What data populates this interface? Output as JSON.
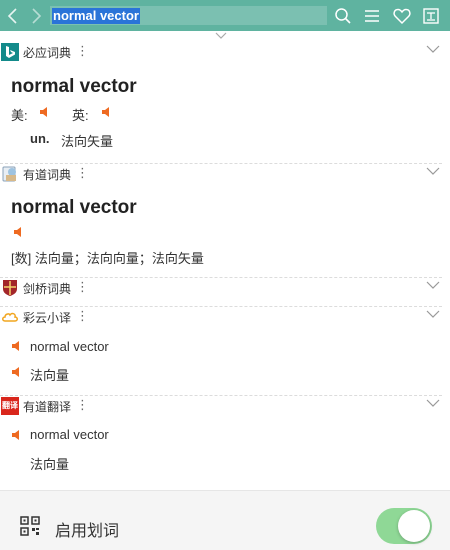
{
  "toolbar": {
    "query": "normal vector",
    "back_icon": "chevron-left-icon",
    "forward_icon": "chevron-right-icon",
    "icons": [
      "search-icon",
      "menu-icon",
      "heart-icon",
      "translate-icon"
    ],
    "bg_color": "#5fb3a0"
  },
  "sections": {
    "bing": {
      "name": "必应词典",
      "word": "normal vector",
      "us_label": "美:",
      "uk_label": "英:",
      "pos": "un.",
      "meaning": "法向矢量"
    },
    "youdao": {
      "name": "有道词典",
      "word": "normal vector",
      "meaning": "[数] 法向量；法向向量；法向矢量"
    },
    "cambridge": {
      "name": "剑桥词典"
    },
    "caiyun": {
      "name": "彩云小译",
      "source": "normal vector",
      "target": "法向量"
    },
    "youdao_trans": {
      "name": "有道翻译",
      "logo_text": "翻译",
      "source": "normal vector",
      "target": "法向量"
    }
  },
  "footer": {
    "label": "启用划词",
    "toggle_on": true,
    "toggle_color": "#8fd896"
  },
  "accent": {
    "speaker": "#ee6a21"
  }
}
